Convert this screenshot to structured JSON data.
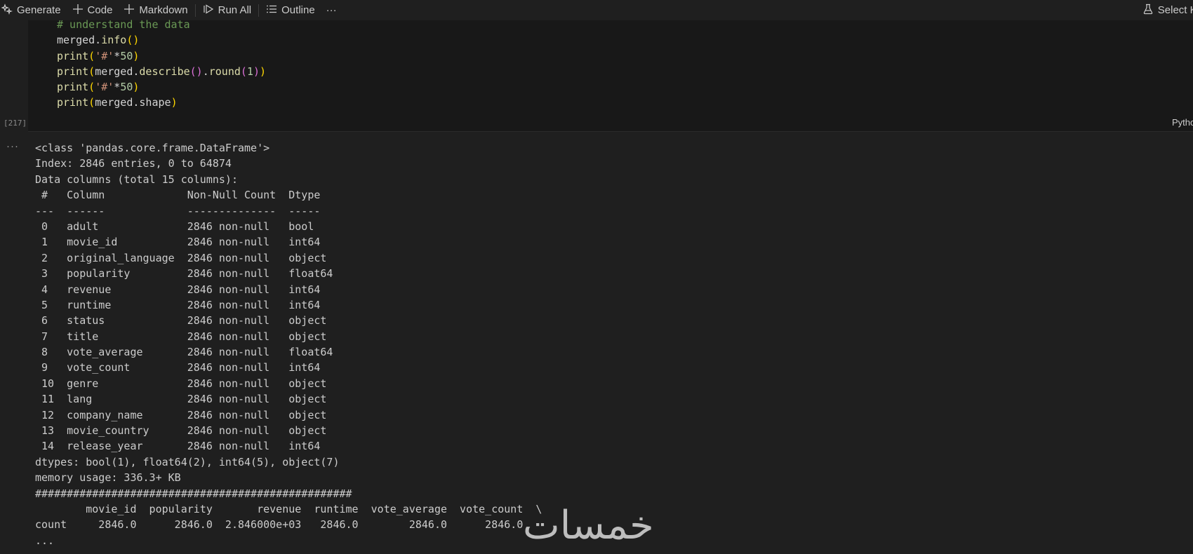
{
  "toolbar": {
    "generate_label": "Generate",
    "code_label": "Code",
    "markdown_label": "Markdown",
    "run_all_label": "Run All",
    "outline_label": "Outline",
    "more_label": "···",
    "select_kernel_label": "Select Ke"
  },
  "cell": {
    "execution_count": "[217]",
    "language": "Pytho",
    "code_lines": [
      "# understand the data",
      "merged.info()",
      "print('#'*50)",
      "print(merged.describe().round(1))",
      "print('#'*50)",
      "print(merged.shape)"
    ]
  },
  "output": {
    "more_label": "···",
    "lines": [
      "<class 'pandas.core.frame.DataFrame'>",
      "Index: 2846 entries, 0 to 64874",
      "Data columns (total 15 columns):",
      " #   Column             Non-Null Count  Dtype  ",
      "---  ------             --------------  -----  ",
      " 0   adult              2846 non-null   bool   ",
      " 1   movie_id           2846 non-null   int64  ",
      " 2   original_language  2846 non-null   object ",
      " 3   popularity         2846 non-null   float64",
      " 4   revenue            2846 non-null   int64  ",
      " 5   runtime            2846 non-null   int64  ",
      " 6   status             2846 non-null   object ",
      " 7   title              2846 non-null   object ",
      " 8   vote_average       2846 non-null   float64",
      " 9   vote_count         2846 non-null   int64  ",
      " 10  genre              2846 non-null   object ",
      " 11  lang               2846 non-null   object ",
      " 12  company_name       2846 non-null   object ",
      " 13  movie_country      2846 non-null   object ",
      " 14  release_year       2846 non-null   int64  ",
      "dtypes: bool(1), float64(2), int64(5), object(7)",
      "memory usage: 336.3+ KB",
      "##################################################",
      "        movie_id  popularity       revenue  runtime  vote_average  vote_count  \\",
      "count     2846.0      2846.0  2.846000e+03   2846.0        2846.0      2846.0  ",
      "..."
    ]
  },
  "watermark": "خمسات"
}
